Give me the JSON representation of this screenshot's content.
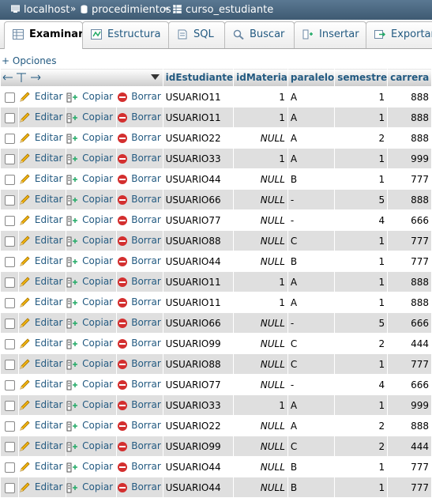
{
  "breadcrumb": {
    "server": "localhost",
    "sep": "»",
    "database": "procedimientos",
    "table": "curso_estudiante"
  },
  "tabs": [
    {
      "label": "Examinar",
      "icon": "browse-icon",
      "active": true
    },
    {
      "label": "Estructura",
      "icon": "structure-icon"
    },
    {
      "label": "SQL",
      "icon": "sql-icon"
    },
    {
      "label": "Buscar",
      "icon": "search-icon"
    },
    {
      "label": "Insertar",
      "icon": "insert-icon"
    },
    {
      "label": "Exportar",
      "icon": "export-icon"
    }
  ],
  "options_link": "+ Opciones",
  "row_actions": {
    "edit": "Editar",
    "copy": "Copiar",
    "delete": "Borrar"
  },
  "columns": [
    "idEstudiante",
    "idMateria",
    "paralelo",
    "semestre",
    "carrera"
  ],
  "null_text": "NULL",
  "rows": [
    {
      "idEstudiante": "USUARIO11",
      "idMateria": "1",
      "paralelo": "A",
      "semestre": "1",
      "carrera": "888"
    },
    {
      "idEstudiante": "USUARIO11",
      "idMateria": "1",
      "paralelo": "A",
      "semestre": "1",
      "carrera": "888"
    },
    {
      "idEstudiante": "USUARIO22",
      "idMateria": "NULL",
      "paralelo": "A",
      "semestre": "2",
      "carrera": "888"
    },
    {
      "idEstudiante": "USUARIO33",
      "idMateria": "1",
      "paralelo": "A",
      "semestre": "1",
      "carrera": "999"
    },
    {
      "idEstudiante": "USUARIO44",
      "idMateria": "NULL",
      "paralelo": "B",
      "semestre": "1",
      "carrera": "777"
    },
    {
      "idEstudiante": "USUARIO66",
      "idMateria": "NULL",
      "paralelo": "-",
      "semestre": "5",
      "carrera": "888"
    },
    {
      "idEstudiante": "USUARIO77",
      "idMateria": "NULL",
      "paralelo": "-",
      "semestre": "4",
      "carrera": "666"
    },
    {
      "idEstudiante": "USUARIO88",
      "idMateria": "NULL",
      "paralelo": "C",
      "semestre": "1",
      "carrera": "777"
    },
    {
      "idEstudiante": "USUARIO44",
      "idMateria": "NULL",
      "paralelo": "B",
      "semestre": "1",
      "carrera": "777"
    },
    {
      "idEstudiante": "USUARIO11",
      "idMateria": "1",
      "paralelo": "A",
      "semestre": "1",
      "carrera": "888"
    },
    {
      "idEstudiante": "USUARIO11",
      "idMateria": "1",
      "paralelo": "A",
      "semestre": "1",
      "carrera": "888"
    },
    {
      "idEstudiante": "USUARIO66",
      "idMateria": "NULL",
      "paralelo": "-",
      "semestre": "5",
      "carrera": "666"
    },
    {
      "idEstudiante": "USUARIO99",
      "idMateria": "NULL",
      "paralelo": "C",
      "semestre": "2",
      "carrera": "444"
    },
    {
      "idEstudiante": "USUARIO88",
      "idMateria": "NULL",
      "paralelo": "C",
      "semestre": "1",
      "carrera": "777"
    },
    {
      "idEstudiante": "USUARIO77",
      "idMateria": "NULL",
      "paralelo": "-",
      "semestre": "4",
      "carrera": "666"
    },
    {
      "idEstudiante": "USUARIO33",
      "idMateria": "1",
      "paralelo": "A",
      "semestre": "1",
      "carrera": "999"
    },
    {
      "idEstudiante": "USUARIO22",
      "idMateria": "NULL",
      "paralelo": "A",
      "semestre": "2",
      "carrera": "888"
    },
    {
      "idEstudiante": "USUARIO99",
      "idMateria": "NULL",
      "paralelo": "C",
      "semestre": "2",
      "carrera": "444"
    },
    {
      "idEstudiante": "USUARIO44",
      "idMateria": "NULL",
      "paralelo": "B",
      "semestre": "1",
      "carrera": "777"
    },
    {
      "idEstudiante": "USUARIO44",
      "idMateria": "NULL",
      "paralelo": "B",
      "semestre": "1",
      "carrera": "777"
    }
  ]
}
